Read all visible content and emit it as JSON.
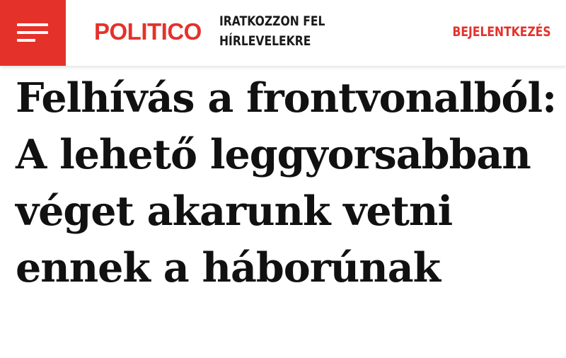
{
  "header": {
    "menu_icon": "hamburger-menu-icon",
    "logo_text": "POLITICO",
    "newsletter_line1": "IRATKOZZON FEL",
    "newsletter_line2": "HÍRLEVELEKRE",
    "login_label": "BEJELENTKEZÉS"
  },
  "article": {
    "headline": "Felhívás a frontvonalból: A lehető leggyorsabban véget akarunk vetni ennek a háborúnak"
  },
  "colors": {
    "brand_red": "#e4322b",
    "text_dark": "#111111",
    "background": "#ffffff"
  }
}
